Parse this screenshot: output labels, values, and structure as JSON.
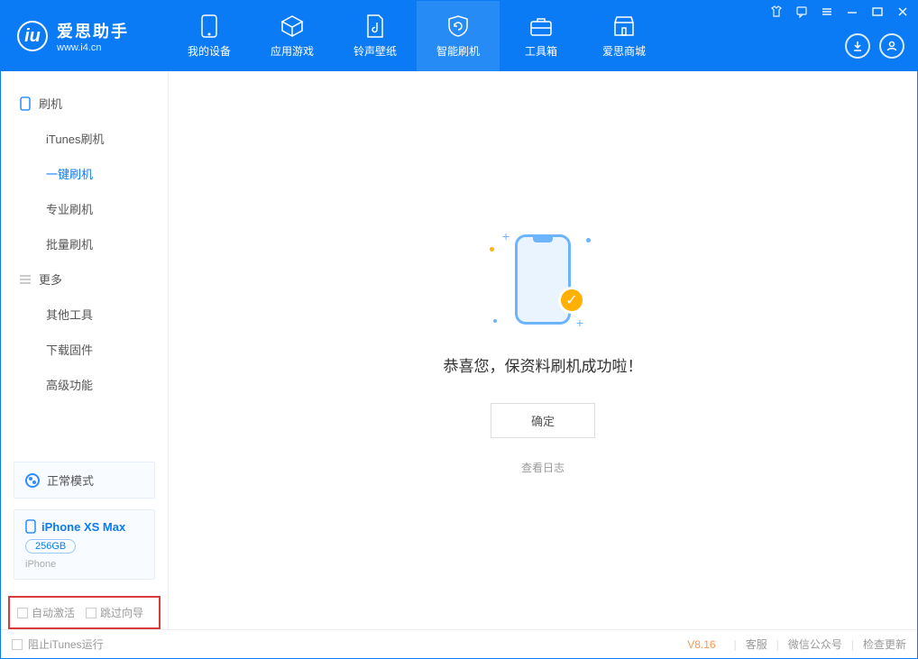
{
  "header": {
    "logo_cn": "爱思助手",
    "logo_url": "www.i4.cn",
    "nav": [
      {
        "id": "device",
        "label": "我的设备"
      },
      {
        "id": "apps",
        "label": "应用游戏"
      },
      {
        "id": "ringwall",
        "label": "铃声壁纸"
      },
      {
        "id": "flash",
        "label": "智能刷机"
      },
      {
        "id": "tools",
        "label": "工具箱"
      },
      {
        "id": "store",
        "label": "爱思商城"
      }
    ],
    "active_nav_index": 3
  },
  "sidebar": {
    "group1_title": "刷机",
    "group1_items": [
      "iTunes刷机",
      "一键刷机",
      "专业刷机",
      "批量刷机"
    ],
    "group1_selected_index": 1,
    "group2_title": "更多",
    "group2_items": [
      "其他工具",
      "下载固件",
      "高级功能"
    ],
    "mode_label": "正常模式",
    "device": {
      "name": "iPhone XS Max",
      "capacity": "256GB",
      "type": "iPhone"
    },
    "chk_auto_activate": "自动激活",
    "chk_skip_guide": "跳过向导"
  },
  "main": {
    "success_message": "恭喜您，保资料刷机成功啦！",
    "confirm_label": "确定",
    "view_log_label": "查看日志"
  },
  "statusbar": {
    "block_itunes_label": "阻止iTunes运行",
    "version": "V8.16",
    "links": [
      "客服",
      "微信公众号",
      "检查更新"
    ]
  }
}
